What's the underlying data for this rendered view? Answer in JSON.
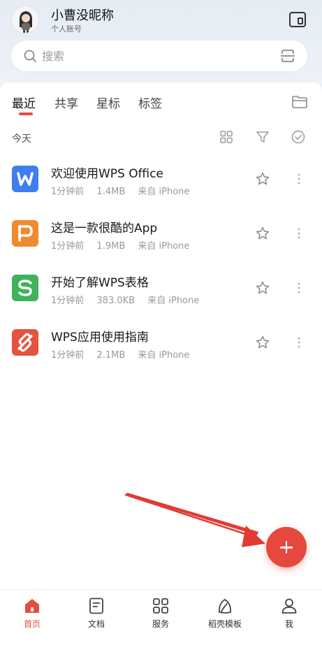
{
  "header": {
    "user_name": "小曹没昵称",
    "user_sub": "个人账号"
  },
  "search": {
    "placeholder": "搜索"
  },
  "tabs": [
    {
      "label": "最近",
      "active": true
    },
    {
      "label": "共享",
      "active": false
    },
    {
      "label": "星标",
      "active": false
    },
    {
      "label": "标签",
      "active": false
    }
  ],
  "section": {
    "label": "今天"
  },
  "files": [
    {
      "name": "欢迎使用WPS Office",
      "time": "1分钟前",
      "size": "1.4MB",
      "source": "来自 iPhone",
      "type": "writer",
      "icon_letter": "W",
      "color": "#3d7ff0"
    },
    {
      "name": "这是一款很酷的App",
      "time": "1分钟前",
      "size": "1.9MB",
      "source": "来自 iPhone",
      "type": "presentation",
      "icon_letter": "P",
      "color": "#ef8a30"
    },
    {
      "name": "开始了解WPS表格",
      "time": "1分钟前",
      "size": "383.0KB",
      "source": "来自 iPhone",
      "type": "spreadsheet",
      "icon_letter": "S",
      "color": "#3fb25a"
    },
    {
      "name": "WPS应用使用指南",
      "time": "1分钟前",
      "size": "2.1MB",
      "source": "来自 iPhone",
      "type": "pdf",
      "icon_letter": "",
      "color": "#e3533f"
    }
  ],
  "bottom_nav": [
    {
      "label": "首页",
      "icon": "home-icon",
      "active": true
    },
    {
      "label": "文档",
      "icon": "document-icon",
      "active": false
    },
    {
      "label": "服务",
      "icon": "grid-icon",
      "active": false
    },
    {
      "label": "稻壳模板",
      "icon": "leaf-icon",
      "active": false
    },
    {
      "label": "我",
      "icon": "user-icon",
      "active": false
    }
  ],
  "colors": {
    "accent": "#e54d42",
    "fab": "#e5483c"
  }
}
